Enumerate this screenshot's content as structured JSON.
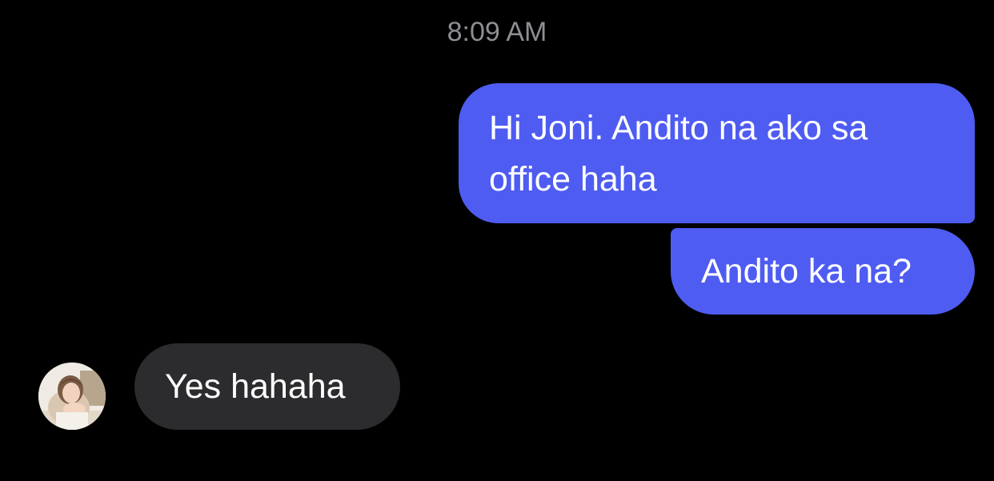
{
  "conversation": {
    "timestamp": "8:09 AM",
    "messages": [
      {
        "direction": "outgoing",
        "text": "Hi Joni. Andito na ako sa office haha"
      },
      {
        "direction": "outgoing",
        "text": "Andito ka na?"
      },
      {
        "direction": "incoming",
        "text": "Yes hahaha"
      }
    ]
  },
  "colors": {
    "background": "#000000",
    "outgoing_bubble": "#4e5cf2",
    "incoming_bubble": "#2c2c2e",
    "timestamp_text": "#8e8e93",
    "message_text": "#ffffff"
  },
  "icons": {
    "contact_avatar": "avatar-photo"
  }
}
